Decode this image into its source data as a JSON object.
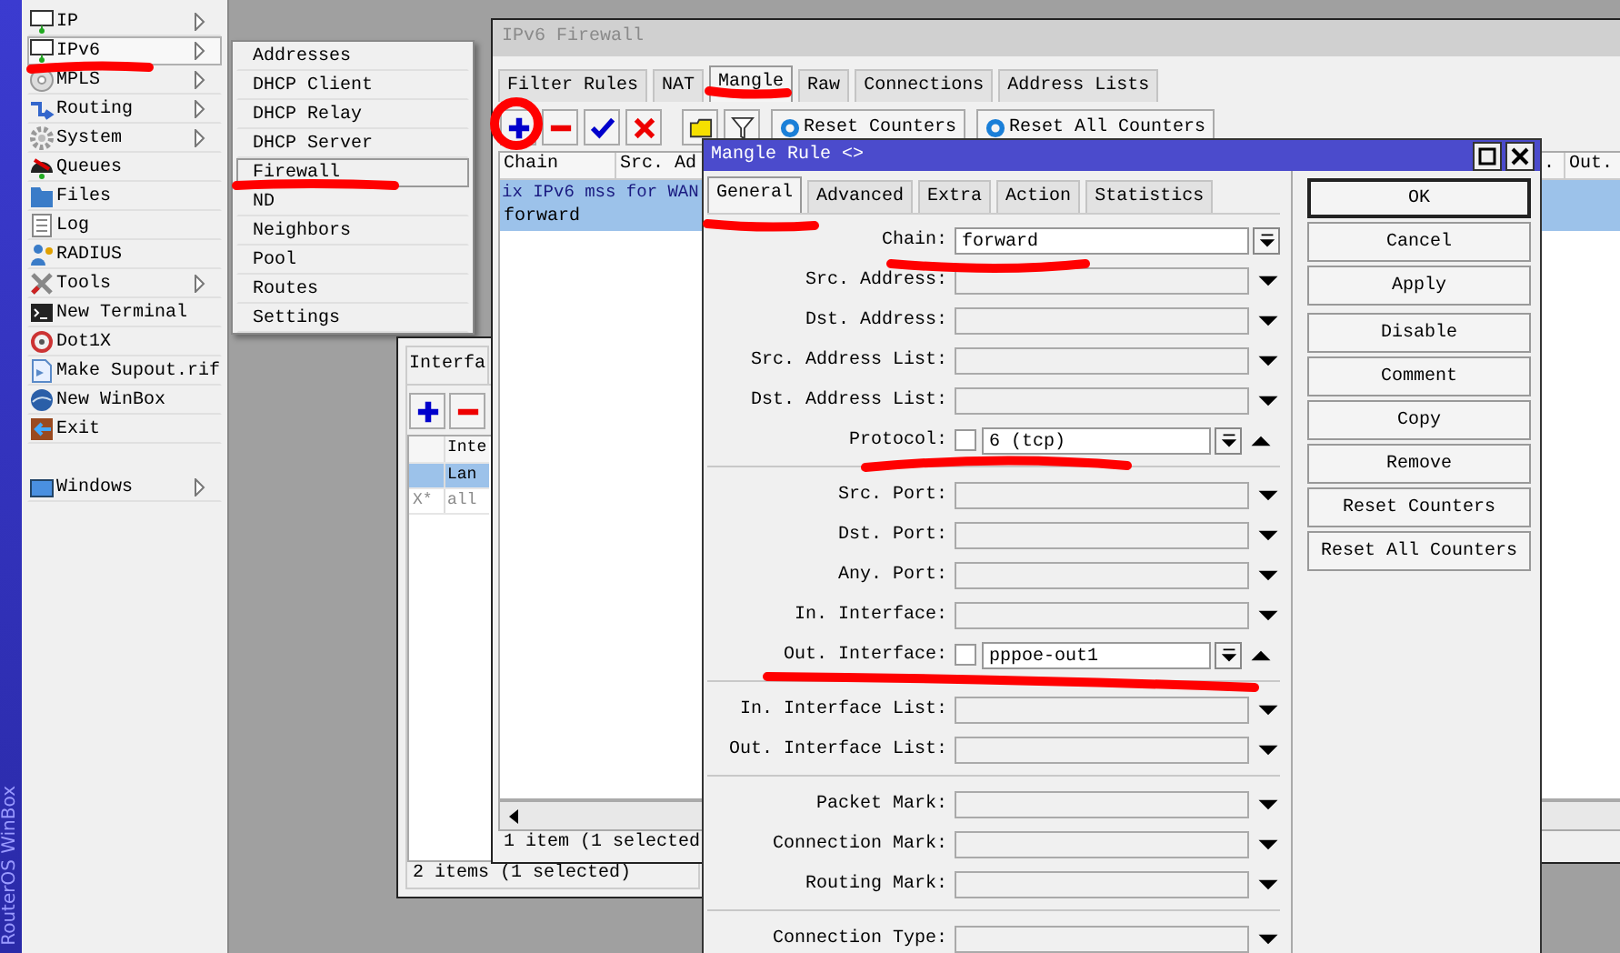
{
  "desktop": {
    "brand": "RouterOS WinBox"
  },
  "main_menu": {
    "items": [
      {
        "label": "IP",
        "has_submenu": true,
        "selected": false
      },
      {
        "label": "IPv6",
        "has_submenu": true,
        "selected": true
      },
      {
        "label": "MPLS",
        "has_submenu": true,
        "selected": false
      },
      {
        "label": "Routing",
        "has_submenu": true,
        "selected": false
      },
      {
        "label": "System",
        "has_submenu": true,
        "selected": false
      },
      {
        "label": "Queues",
        "has_submenu": false,
        "selected": false
      },
      {
        "label": "Files",
        "has_submenu": false,
        "selected": false
      },
      {
        "label": "Log",
        "has_submenu": false,
        "selected": false
      },
      {
        "label": "RADIUS",
        "has_submenu": false,
        "selected": false
      },
      {
        "label": "Tools",
        "has_submenu": true,
        "selected": false
      },
      {
        "label": "New Terminal",
        "has_submenu": false,
        "selected": false
      },
      {
        "label": "Dot1X",
        "has_submenu": false,
        "selected": false
      },
      {
        "label": "Make Supout.rif",
        "has_submenu": false,
        "selected": false
      },
      {
        "label": "New WinBox",
        "has_submenu": false,
        "selected": false
      },
      {
        "label": "Exit",
        "has_submenu": false,
        "selected": false
      }
    ],
    "bottom_items": [
      {
        "label": "Windows",
        "has_submenu": true,
        "selected": false
      }
    ]
  },
  "submenu": {
    "items": [
      {
        "label": "Addresses",
        "selected": false
      },
      {
        "label": "DHCP Client",
        "selected": false
      },
      {
        "label": "DHCP Relay",
        "selected": false
      },
      {
        "label": "DHCP Server",
        "selected": false
      },
      {
        "label": "Firewall",
        "selected": true
      },
      {
        "label": "ND",
        "selected": false
      },
      {
        "label": "Neighbors",
        "selected": false
      },
      {
        "label": "Pool",
        "selected": false
      },
      {
        "label": "Routes",
        "selected": false
      },
      {
        "label": "Settings",
        "selected": false
      }
    ]
  },
  "interface_window": {
    "tab": "Interfa",
    "column_2": "Inte",
    "rows": [
      {
        "name": "Lan",
        "selected": true,
        "disabled": false
      },
      {
        "flag": "X*",
        "name": "all",
        "selected": false,
        "disabled": true
      }
    ],
    "status": "2 items (1 selected)"
  },
  "firewall_window": {
    "title": "IPv6 Firewall",
    "tabs": [
      {
        "label": "Filter Rules",
        "selected": false
      },
      {
        "label": "NAT",
        "selected": false
      },
      {
        "label": "Mangle",
        "selected": true
      },
      {
        "label": "Raw",
        "selected": false
      },
      {
        "label": "Connections",
        "selected": false
      },
      {
        "label": "Address Lists",
        "selected": false
      }
    ],
    "toolbar_buttons": [
      "Reset Counters",
      "Reset All Counters"
    ],
    "columns": [
      "Chain",
      "Src. Ad",
      ".",
      "Out."
    ],
    "rows": [
      {
        "kind": "comment",
        "text": "ix IPv6 mss for WAN",
        "selected": true
      },
      {
        "kind": "rule",
        "chain": "forward",
        "selected": true
      }
    ],
    "status": "1 item (1 selected"
  },
  "mangle_dialog": {
    "title": "Mangle Rule <>",
    "tabs": [
      {
        "label": "General",
        "selected": true
      },
      {
        "label": "Advanced",
        "selected": false
      },
      {
        "label": "Extra",
        "selected": false
      },
      {
        "label": "Action",
        "selected": false
      },
      {
        "label": "Statistics",
        "selected": false
      }
    ],
    "field_groups": [
      [
        {
          "label": "Chain:",
          "kind": "select",
          "value": "forward"
        },
        {
          "label": "Src. Address:",
          "kind": "empty"
        },
        {
          "label": "Dst. Address:",
          "kind": "empty"
        },
        {
          "label": "Src. Address List:",
          "kind": "empty"
        },
        {
          "label": "Dst. Address List:",
          "kind": "empty"
        },
        {
          "label": "Protocol:",
          "kind": "negatable",
          "checked": false,
          "value": "6 (tcp)"
        }
      ],
      [
        {
          "label": "Src. Port:",
          "kind": "empty"
        },
        {
          "label": "Dst. Port:",
          "kind": "empty"
        },
        {
          "label": "Any. Port:",
          "kind": "empty"
        },
        {
          "label": "In. Interface:",
          "kind": "empty"
        },
        {
          "label": "Out. Interface:",
          "kind": "negatable",
          "checked": false,
          "value": "pppoe-out1"
        }
      ],
      [
        {
          "label": "In. Interface List:",
          "kind": "empty"
        },
        {
          "label": "Out. Interface List:",
          "kind": "empty"
        }
      ],
      [
        {
          "label": "Packet Mark:",
          "kind": "empty"
        },
        {
          "label": "Connection Mark:",
          "kind": "empty"
        },
        {
          "label": "Routing Mark:",
          "kind": "empty"
        }
      ],
      [
        {
          "label": "Connection Type:",
          "kind": "empty"
        }
      ]
    ],
    "button_groups": [
      [
        {
          "label": "OK",
          "default": true
        },
        {
          "label": "Cancel",
          "default": false
        },
        {
          "label": "Apply",
          "default": false
        }
      ],
      [
        {
          "label": "Disable",
          "default": false
        },
        {
          "label": "Comment",
          "default": false
        },
        {
          "label": "Copy",
          "default": false
        },
        {
          "label": "Remove",
          "default": false
        },
        {
          "label": "Reset Counters",
          "default": false
        },
        {
          "label": "Reset All Counters",
          "default": false
        }
      ]
    ]
  }
}
